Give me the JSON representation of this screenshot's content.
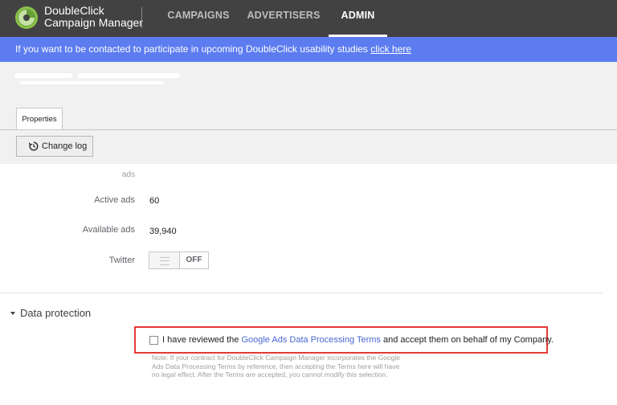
{
  "header": {
    "brand_line1": "DoubleClick",
    "brand_line2": "Campaign Manager",
    "logo": "doubleclick-logo",
    "nav": [
      {
        "label": "CAMPAIGNS",
        "active": false
      },
      {
        "label": "ADVERTISERS",
        "active": false
      },
      {
        "label": "ADMIN",
        "active": true
      }
    ]
  },
  "banner": {
    "text": "If you want to be contacted to participate in upcoming DoubleClick usability studies",
    "link": "click here",
    "color": "#5c7cf0"
  },
  "tabs": {
    "properties": "Properties"
  },
  "toolbar": {
    "change_log": "Change log",
    "change_log_icon": "history-icon"
  },
  "fields": {
    "cut_label": "ads",
    "active_ads_label": "Active ads",
    "active_ads_value": "60",
    "available_ads_label": "Available ads",
    "available_ads_value": "39,940",
    "twitter_label": "Twitter",
    "twitter_state": "OFF"
  },
  "data_protection": {
    "title": "Data protection",
    "consent_prefix": "I have reviewed the",
    "consent_link": "Google Ads Data Processing Terms",
    "consent_suffix": "and accept them on behalf of my Company.",
    "checked": false,
    "note_line1": "Note: If your contract for DoubleClick Campaign Manager incorporates the Google",
    "note_line2": "Ads Data Processing Terms by reference, then accepting the Terms here will have",
    "note_line3": "no legal effect. After the Terms are accepted, you cannot modify this selection."
  },
  "colors": {
    "topbar": "#424242",
    "accent_link": "#4a67d4",
    "highlight": "#e53935"
  }
}
